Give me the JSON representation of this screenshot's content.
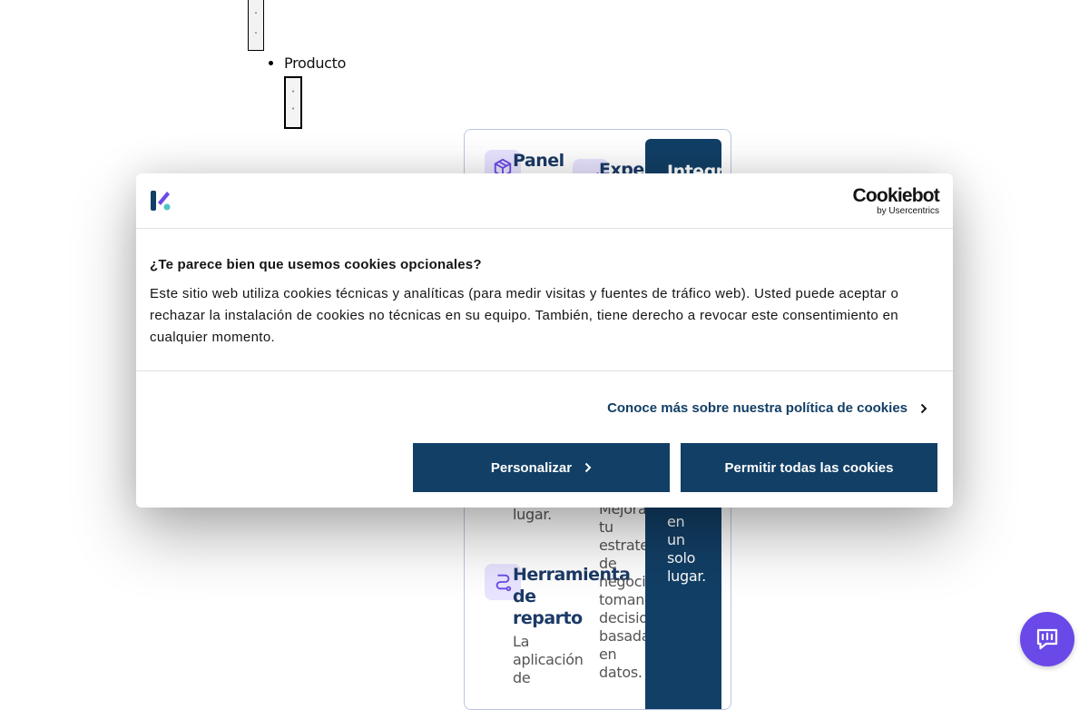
{
  "nav": {
    "toggle_glyphs": [
      "˄",
      "˅"
    ],
    "items": [
      {
        "label": "Producto"
      }
    ],
    "sub_toggle_glyphs": [
      "˄",
      "˅"
    ]
  },
  "mega_menu": {
    "columns": [
      {
        "title": "Panel",
        "body_visible": "lugar.",
        "icon": "box-icon"
      },
      {
        "title": "Experi",
        "body_lines": [
          "Mejora",
          "tu",
          "estrateg",
          "de",
          "negocio",
          "tomando",
          "decision",
          "basadas",
          "en",
          "datos."
        ],
        "icon": "chart-icon"
      },
      {
        "title": "Integra",
        "body_lines": [
          "en",
          "un",
          "solo",
          "lugar."
        ]
      }
    ],
    "second_item": {
      "title_lines": [
        "Herramienta",
        "de",
        "reparto"
      ],
      "body_lines": [
        "La",
        "aplicación",
        "de"
      ],
      "icon": "route-icon"
    }
  },
  "cookie_dialog": {
    "brand_logo": "brand-k-logo",
    "cookiebot_word": "Cookiebot",
    "cookiebot_by": "by Usercentrics",
    "title": "¿Te parece bien que usemos cookies opcionales?",
    "description": "Este sitio web utiliza cookies técnicas y analíticas (para medir visitas y fuentes de tráfico web). Usted puede aceptar o rechazar la instalación de cookies no técnicas en su equipo. También, tiene derecho a revocar este consentimiento en cualquier momento.",
    "policy_link": "Conoce más sobre nuestra política de cookies",
    "customize_label": "Personalizar",
    "allow_all_label": "Permitir todas las cookies"
  },
  "colors": {
    "primary": "#123f66",
    "accent": "#6a49e8",
    "icon_bg": "#e9e4ff"
  },
  "chat": {
    "icon": "chat-bubble-icon"
  }
}
